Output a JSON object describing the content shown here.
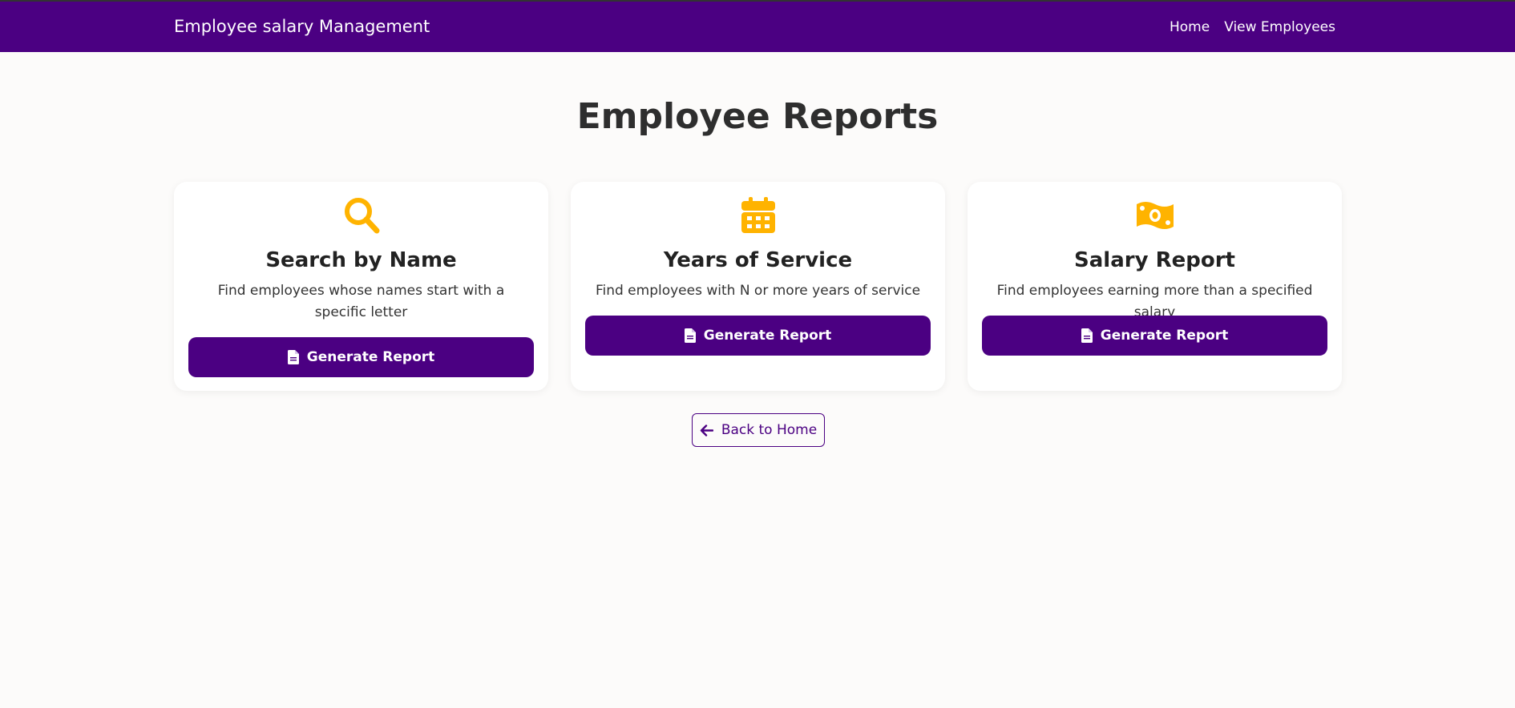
{
  "navbar": {
    "brand": "Employee salary Management",
    "links": [
      {
        "label": "Home"
      },
      {
        "label": "View Employees"
      }
    ],
    "background": "#4b0082"
  },
  "page": {
    "title": "Employee Reports"
  },
  "cards": [
    {
      "icon": "search-icon",
      "title": "Search by Name",
      "description": "Find employees whose names start with a specific letter",
      "button_label": "Generate Report"
    },
    {
      "icon": "calendar-icon",
      "title": "Years of Service",
      "description": "Find employees with N or more years of service",
      "button_label": "Generate Report"
    },
    {
      "icon": "money-bill-icon",
      "title": "Salary Report",
      "description": "Find employees earning more than a specified salary",
      "button_label": "Generate Report"
    }
  ],
  "back_button": {
    "label": "Back to Home",
    "icon": "arrow-left-icon"
  },
  "colors": {
    "accent": "#4b0082",
    "icon": "#ffb300",
    "background": "#fcfbfa"
  }
}
